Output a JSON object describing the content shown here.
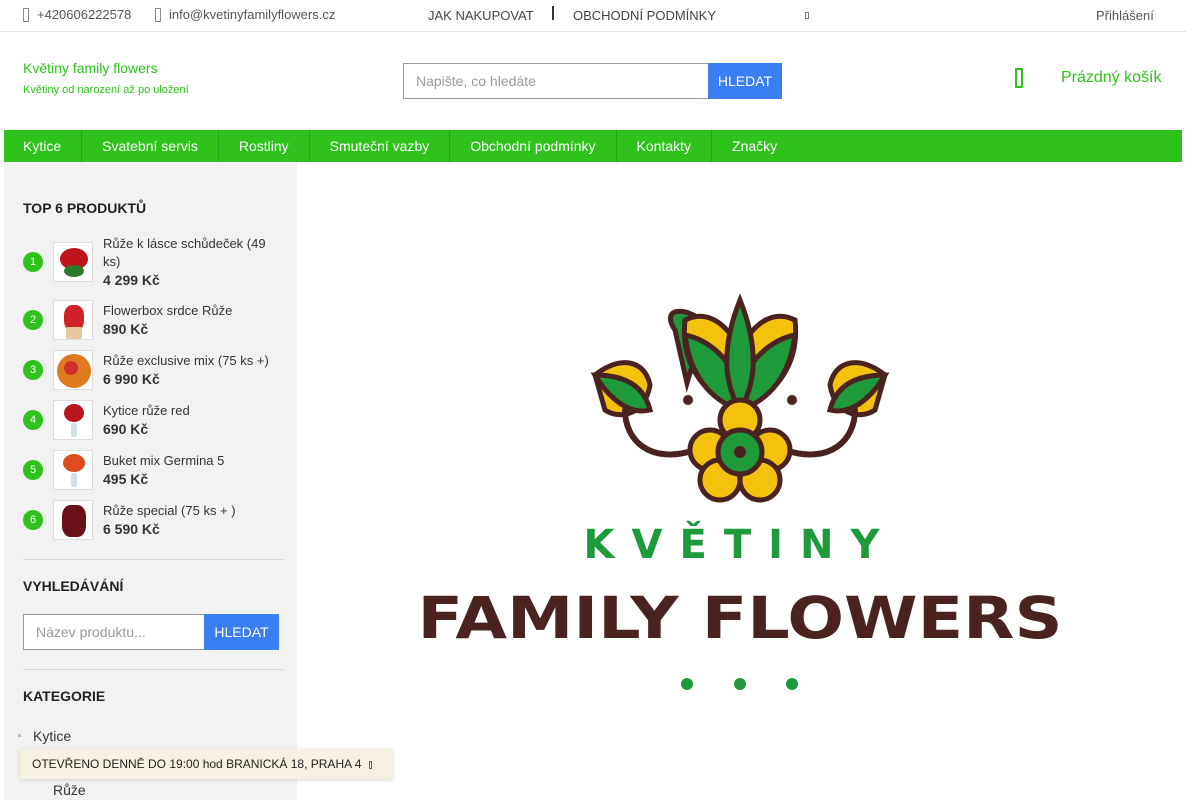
{
  "topbar": {
    "phone": "+420606222578",
    "email": "info@kvetinyfamilyflowers.cz",
    "how_to_buy": "JAK NAKUPOVAT",
    "terms": "OBCHODNÍ PODMÍNKY",
    "login": "Přihlášení"
  },
  "brand": {
    "name": "Květiny family flowers",
    "tagline": "Květiny od narození až po uložení"
  },
  "search": {
    "placeholder": "Napište, co hledáte",
    "button": "HLEDAT"
  },
  "cart": {
    "label": "Prázdný košík"
  },
  "nav": {
    "items": [
      "Kytice",
      "Svatební servis",
      "Rostliny",
      "Smuteční vazby",
      "Obchodní podmínky",
      "Kontakty",
      "Značky"
    ]
  },
  "sidebar": {
    "top_title": "TOP 6 PRODUKTŮ",
    "products": [
      {
        "num": "1",
        "name": "Růže k lásce schůdeček (49 ks)",
        "price": "4 299 Kč"
      },
      {
        "num": "2",
        "name": "Flowerbox srdce Růže",
        "price": "890 Kč"
      },
      {
        "num": "3",
        "name": "Růže exclusive mix (75 ks +)",
        "price": "6 990 Kč"
      },
      {
        "num": "4",
        "name": "Kytice růže red",
        "price": "690 Kč"
      },
      {
        "num": "5",
        "name": "Buket mix Germina 5",
        "price": "495 Kč"
      },
      {
        "num": "6",
        "name": "Růže special (75 ks + )",
        "price": "6 590 Kč"
      }
    ],
    "search_title": "VYHLEDÁVÁNÍ",
    "search_placeholder": "Název produktu...",
    "search_button": "HLEDAT",
    "category_title": "KATEGORIE",
    "categories": [
      "Kytice",
      "Růže"
    ]
  },
  "notice": {
    "text": "OTEVŘENO DENNĚ DO 19:00 hod BRANICKÁ 18, PRAHA 4"
  },
  "logo": {
    "line1": "KVĚTINY",
    "line2": "FAMILY FLOWERS"
  },
  "colors": {
    "accent": "#2fc21c",
    "button": "#3a7ef3",
    "logo_green": "#1f9a3a",
    "logo_brown": "#4a2320",
    "logo_yellow": "#f4c20d"
  }
}
